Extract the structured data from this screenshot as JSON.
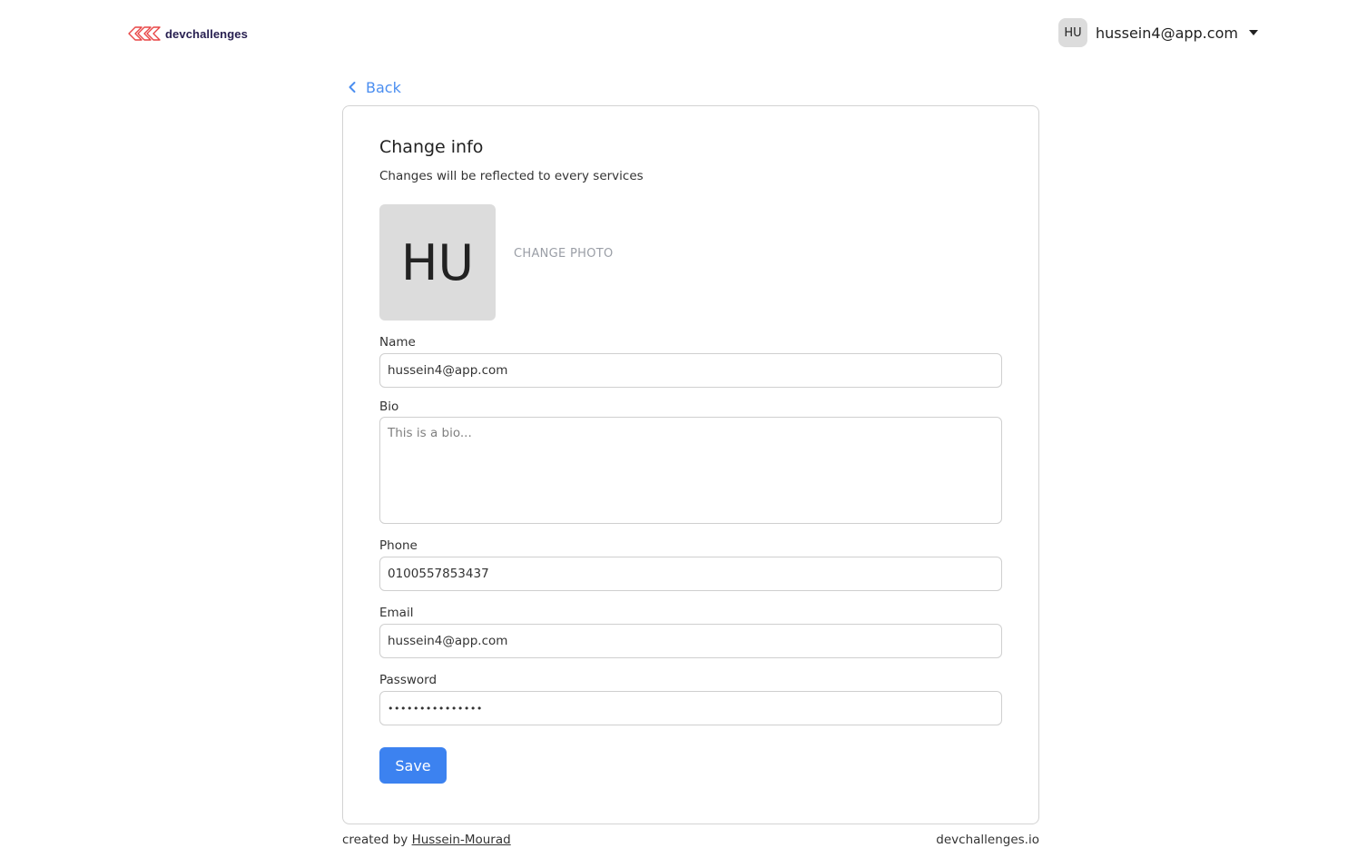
{
  "header": {
    "logo_text": "devchallenges",
    "user_initials": "HU",
    "user_email": "hussein4@app.com"
  },
  "back": {
    "label": "Back"
  },
  "card": {
    "title": "Change info",
    "subtitle": "Changes will be reflected to every services",
    "avatar_initials": "HU",
    "change_photo_label": "CHANGE PHOTO"
  },
  "form": {
    "name": {
      "label": "Name",
      "value": "hussein4@app.com"
    },
    "bio": {
      "label": "Bio",
      "value": "",
      "placeholder": "This is a bio..."
    },
    "phone": {
      "label": "Phone",
      "value": "0100557853437"
    },
    "email": {
      "label": "Email",
      "value": "hussein4@app.com"
    },
    "password": {
      "label": "Password",
      "value": "•••••••••••••••"
    },
    "save_label": "Save"
  },
  "footer": {
    "created_by": "created by",
    "author": "Hussein-Mourad",
    "site": "devchallenges.io"
  },
  "colors": {
    "accent": "#3c82f0",
    "link": "#4b8ef0",
    "avatar_bg": "#dcdcdc",
    "logo_red": "#e84545"
  },
  "icons": {
    "logo": "devchallenges-logo-icon",
    "caret": "caret-down-icon",
    "back": "chevron-left-icon"
  }
}
